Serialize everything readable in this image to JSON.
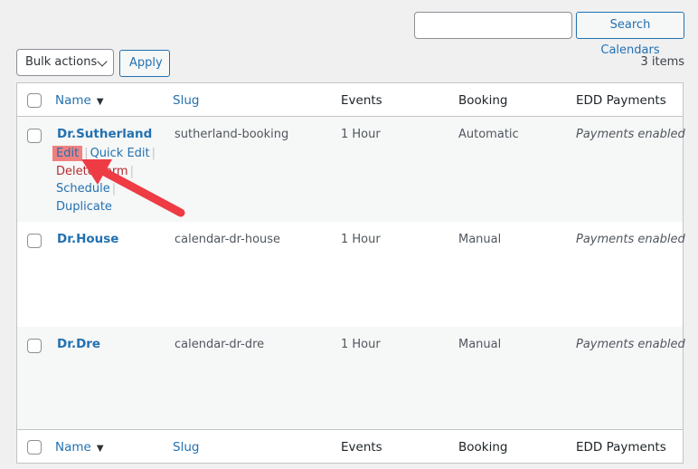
{
  "search": {
    "placeholder": "",
    "value": "",
    "button_label": "Search Calendars"
  },
  "toolbar": {
    "bulk_actions_label": "Bulk actions",
    "apply_label": "Apply",
    "item_count": "3 items"
  },
  "table": {
    "columns": {
      "name": "Name",
      "slug": "Slug",
      "events": "Events",
      "booking": "Booking",
      "payments": "EDD Payments"
    },
    "sort_indicator": "▼",
    "rows": [
      {
        "name": "Dr.Sutherland",
        "slug": "sutherland-booking",
        "events": "1 Hour",
        "booking": "Automatic",
        "payments": "Payments enabled"
      },
      {
        "name": "Dr.House",
        "slug": "calendar-dr-house",
        "events": "1 Hour",
        "booking": "Manual",
        "payments": "Payments enabled"
      },
      {
        "name": "Dr.Dre",
        "slug": "calendar-dr-dre",
        "events": "1 Hour",
        "booking": "Manual",
        "payments": "Payments enabled"
      }
    ],
    "row_actions": {
      "edit": "Edit",
      "quick_edit": "Quick Edit",
      "delete": "Delete Form",
      "schedule": "Schedule",
      "duplicate": "Duplicate",
      "separator": "|"
    }
  },
  "annotation": {
    "color": "#ee3b44",
    "highlight_color": "#f08080"
  }
}
